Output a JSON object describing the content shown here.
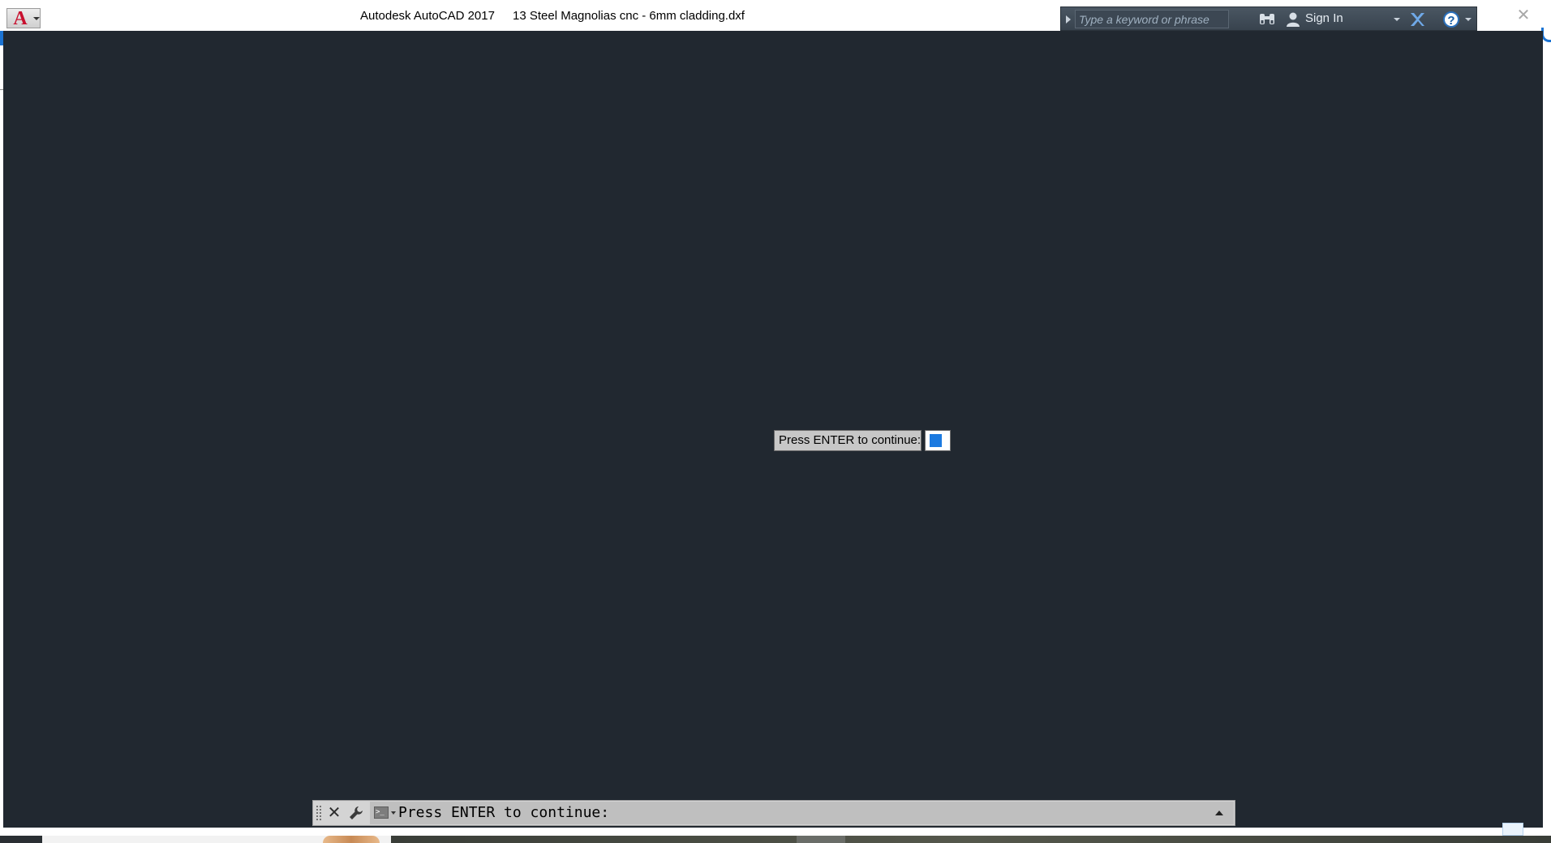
{
  "titlebar": {
    "product": "Autodesk AutoCAD 2017",
    "file_name": "13 Steel Magnolias cnc - 6mm cladding.dxf",
    "app_menu_icon": "autocad-logo-icon"
  },
  "infocenter": {
    "search_placeholder": "Type a keyword or phrase",
    "search_value": "",
    "sign_in_label": "Sign In",
    "help_glyph": "?",
    "icons": [
      "expand-arrow-icon",
      "binoculars-icon",
      "user-icon",
      "exchange-x-icon",
      "help-icon"
    ]
  },
  "window": {
    "close_glyph": "✕"
  },
  "drawing": {
    "background_color": "#212830",
    "dynamic_prompt": "Press ENTER to continue:"
  },
  "command_line": {
    "close_glyph": "✕",
    "prompt_text": "Press ENTER to continue:",
    "prompt_icon_glyph": ">_"
  }
}
